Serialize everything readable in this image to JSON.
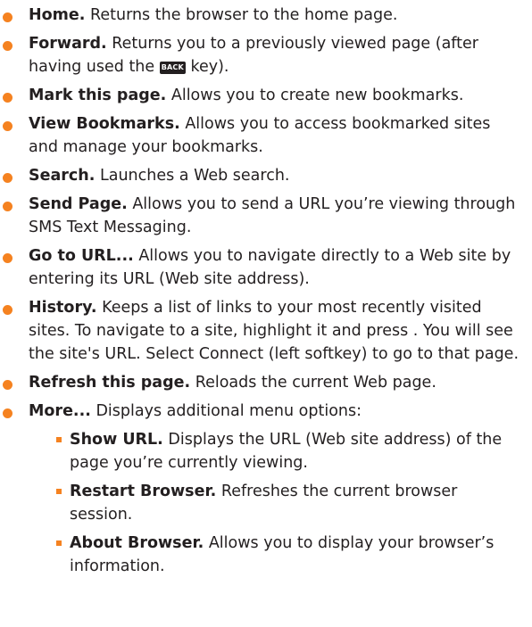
{
  "items": [
    {
      "term": "Home.",
      "desc": " Returns the browser to the home page."
    },
    {
      "term": "Forward.",
      "desc_before_key": " Returns you to a previously viewed page (after having used the ",
      "key_label": "BACK",
      "desc_after_key": " key)."
    },
    {
      "term": "Mark this page.",
      "desc": " Allows you to create new bookmarks."
    },
    {
      "term": "View Bookmarks.",
      "desc": " Allows you to access bookmarked sites and manage your bookmarks."
    },
    {
      "term": "Search.",
      "desc": " Launches a Web search."
    },
    {
      "term": "Send Page.",
      "desc": " Allows you to send a URL you’re viewing through SMS Text Messaging."
    },
    {
      "term": "Go to URL...",
      "desc": " Allows you to navigate directly to a Web site by entering its URL (Web site address)."
    },
    {
      "term": "History.",
      "desc": " Keeps a list of links to your most recently visited sites. To navigate to a site, highlight it and press . You will see the site's URL. Select Connect (left softkey) to go to that page."
    },
    {
      "term": "Refresh this page.",
      "desc": " Reloads the current Web page."
    },
    {
      "term": "More...",
      "desc": " Displays additional menu options:"
    }
  ],
  "subitems": [
    {
      "term": "Show URL.",
      "desc": " Displays the URL (Web site address) of the page you’re currently viewing."
    },
    {
      "term": "Restart Browser.",
      "desc": " Refreshes the current browser session."
    },
    {
      "term": "About Browser.",
      "desc": " Allows you to display your browser’s information."
    }
  ],
  "colors": {
    "bullet": "#f58220",
    "text": "#231f20"
  }
}
